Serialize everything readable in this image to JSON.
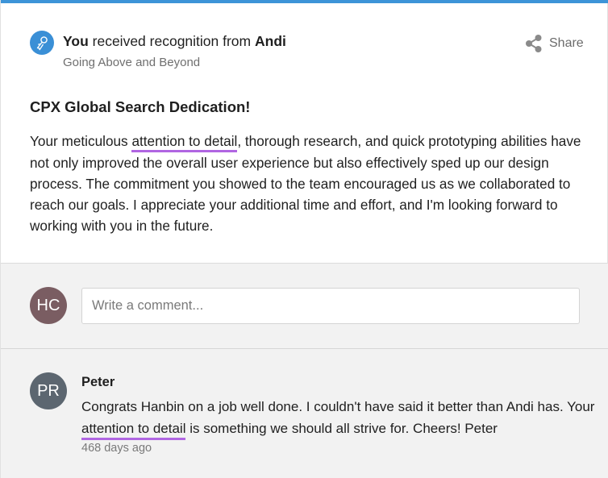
{
  "header": {
    "recipient": "You",
    "received_text": "received recognition from",
    "sender": "Andi",
    "award": "Going Above and Beyond",
    "share_label": "Share",
    "badge_icon": "award-ribbon-icon",
    "share_icon": "share-icon"
  },
  "recognition": {
    "title": "CPX Global Search Dedication!",
    "message_before": "Your meticulous ",
    "message_highlight": "attention to detail",
    "message_after": ", thorough research, and quick prototyping abilities have not only improved the overall user experience but also effectively sped up our design process. The commitment you showed to the team encouraged us as we collaborated to reach our goals. I appreciate your additional time and effort, and I'm looking forward to working with you in the future."
  },
  "comment_box": {
    "avatar_initials": "HC",
    "placeholder": "Write a comment..."
  },
  "comments": [
    {
      "avatar_initials": "PR",
      "author": "Peter",
      "text_before": "Congrats Hanbin on a job well done. I couldn't have said it better than Andi has. Your ",
      "text_highlight": "attention to detail",
      "text_after": " is something we should all strive for. Cheers! Peter",
      "time": "468 days ago"
    }
  ],
  "colors": {
    "accent_blue": "#3d94d8",
    "highlight_purple": "#b066e2",
    "avatar_hc": "#7a5d62",
    "avatar_pr": "#5c6670"
  }
}
